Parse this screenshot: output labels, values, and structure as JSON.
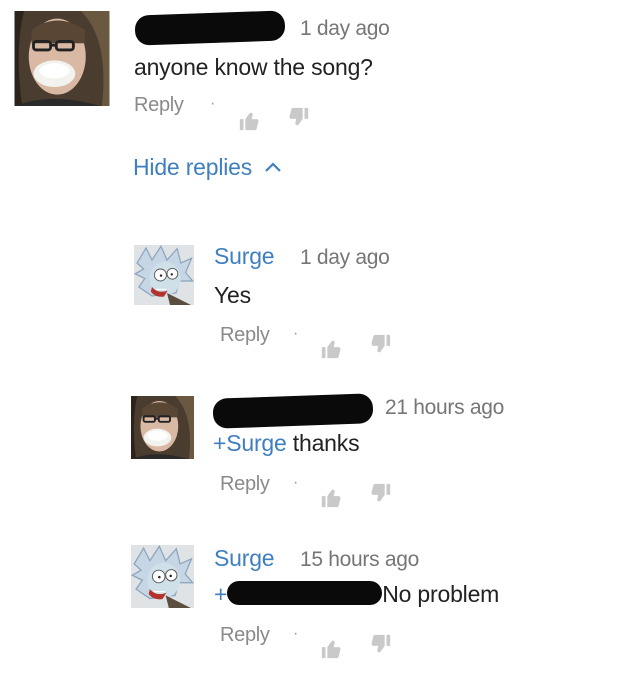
{
  "comments": [
    {
      "timestamp": "1 day ago",
      "text": "anyone know the song?",
      "reply_label": "Reply"
    },
    {
      "author": "Surge",
      "timestamp": "1 day ago",
      "text": "Yes",
      "reply_label": "Reply"
    },
    {
      "timestamp": "21 hours ago",
      "mention": "+Surge",
      "text": " thanks",
      "reply_label": "Reply"
    },
    {
      "author": "Surge",
      "timestamp": "15 hours ago",
      "mention": "+",
      "text": "No problem",
      "reply_label": "Reply"
    }
  ],
  "hide_replies": {
    "label": "Hide replies",
    "icon": "chevron-up-icon"
  },
  "separator": "·",
  "icons": {
    "like": "thumbs-up-icon",
    "dislike": "thumbs-down-icon"
  },
  "colors": {
    "link_blue": "#3f7fc1",
    "meta_gray": "#767676",
    "text": "#222222"
  }
}
